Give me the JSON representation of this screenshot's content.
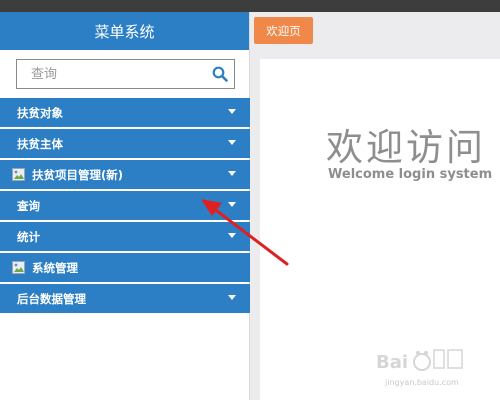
{
  "sidebar": {
    "title": "菜单系统",
    "search": {
      "placeholder": "查询",
      "value": ""
    },
    "items": [
      {
        "label": "扶贫对象",
        "has_icon": false,
        "has_caret": true
      },
      {
        "label": "扶贫主体",
        "has_icon": false,
        "has_caret": true
      },
      {
        "label": "扶贫项目管理(新)",
        "has_icon": true,
        "has_caret": true
      },
      {
        "label": "查询",
        "has_icon": false,
        "has_caret": true
      },
      {
        "label": "统计",
        "has_icon": false,
        "has_caret": true
      },
      {
        "label": "系统管理",
        "has_icon": true,
        "has_caret": false
      },
      {
        "label": "后台数据管理",
        "has_icon": false,
        "has_caret": true
      }
    ]
  },
  "main": {
    "tabs": [
      {
        "label": "欢迎页"
      }
    ],
    "welcome": {
      "title": "欢迎访问",
      "subtitle": "Welcome login system"
    }
  },
  "watermark": {
    "text": "jingyan.baidu.com"
  },
  "colors": {
    "sidebar_header": "#2c7fc4",
    "menu_item": "#2c7fc4",
    "tab_active": "#f0884a",
    "topbar": "#3d3d3d",
    "arrow": "#e02020",
    "welcome_text": "#8e8e8e"
  }
}
